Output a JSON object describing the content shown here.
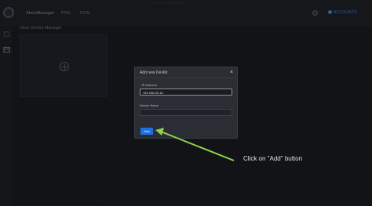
{
  "app": {
    "title": "XboxManager",
    "tabs": [
      "PRE",
      "PGN"
    ],
    "brand": "XXXXXXXXX",
    "account_label": "ACCOUNTS"
  },
  "page": {
    "title": "Xbox DevKit Manager"
  },
  "modal": {
    "title": "Add new DevKit",
    "ip_label": "IP Address",
    "ip_value": "192.168.20.18",
    "device_label": "Device Name",
    "device_value": "",
    "add_label": "Add"
  },
  "annotation": {
    "text": "Click on \"Add\" button",
    "color": "#8fd14f"
  },
  "icons": {
    "close": "close-icon",
    "plus": "plus-icon"
  },
  "colors": {
    "accent": "#1f6fe0",
    "required": "#e04848",
    "account": "#4da3ff"
  }
}
